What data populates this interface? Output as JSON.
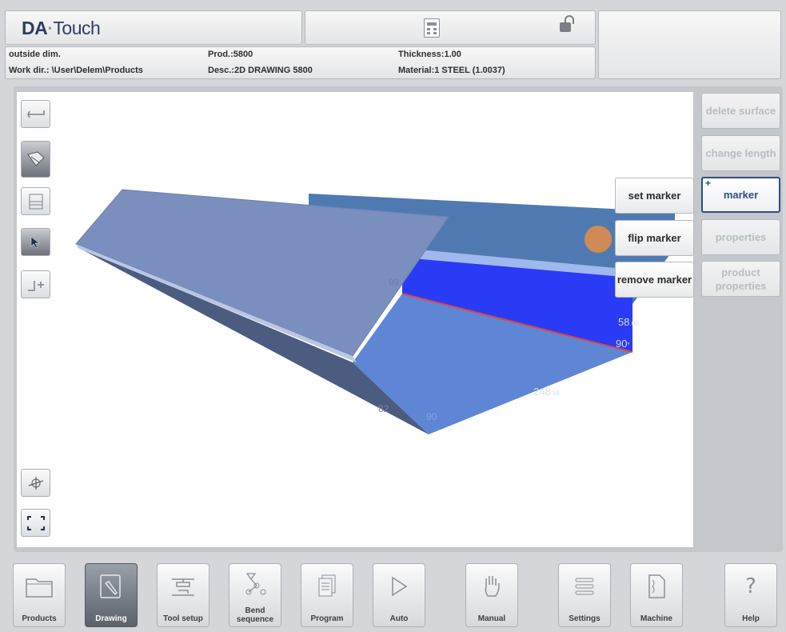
{
  "header": {
    "brand_prefix": "DA",
    "brand_dot": "·",
    "brand_suffix": "Touch"
  },
  "info": {
    "dim_mode": "outside dim.",
    "product": "Prod.:5800",
    "thickness": "Thickness:1.00",
    "work_dir": "Work dir.: \\User\\Delem\\Products",
    "description": "Desc.:2D DRAWING 5800",
    "material": "Material:1 STEEL (1.0037)"
  },
  "right_panel": {
    "delete_surface": "delete surface",
    "change_length": "change length",
    "marker": "marker",
    "properties": "properties",
    "product_properties": "product properties"
  },
  "marker_menu": {
    "set_marker": "set marker",
    "flip_marker": "flip marker",
    "remove_marker": "remove marker"
  },
  "dimensions": {
    "d1": "99",
    "d2": "58",
    "d2_small": ".00",
    "d3": "90",
    "d3_small": "°",
    "d4": "248",
    "d4_small": ".58",
    "d5": "82",
    "d6": "90"
  },
  "nav": {
    "products": "Products",
    "drawing": "Drawing",
    "tool_setup": "Tool setup",
    "bend_sequence_1": "Bend",
    "bend_sequence_2": "sequence",
    "program": "Program",
    "auto": "Auto",
    "manual": "Manual",
    "settings": "Settings",
    "machine": "Machine",
    "help": "Help"
  },
  "colors": {
    "accent": "#2f4d7e",
    "part_top": "#7b8fbe",
    "part_side": "#4c5b80",
    "part_inner": "#2a3bf5",
    "marker": "#d08a55"
  },
  "state": {
    "active_nav": "Drawing",
    "active_side_button": "marker"
  }
}
